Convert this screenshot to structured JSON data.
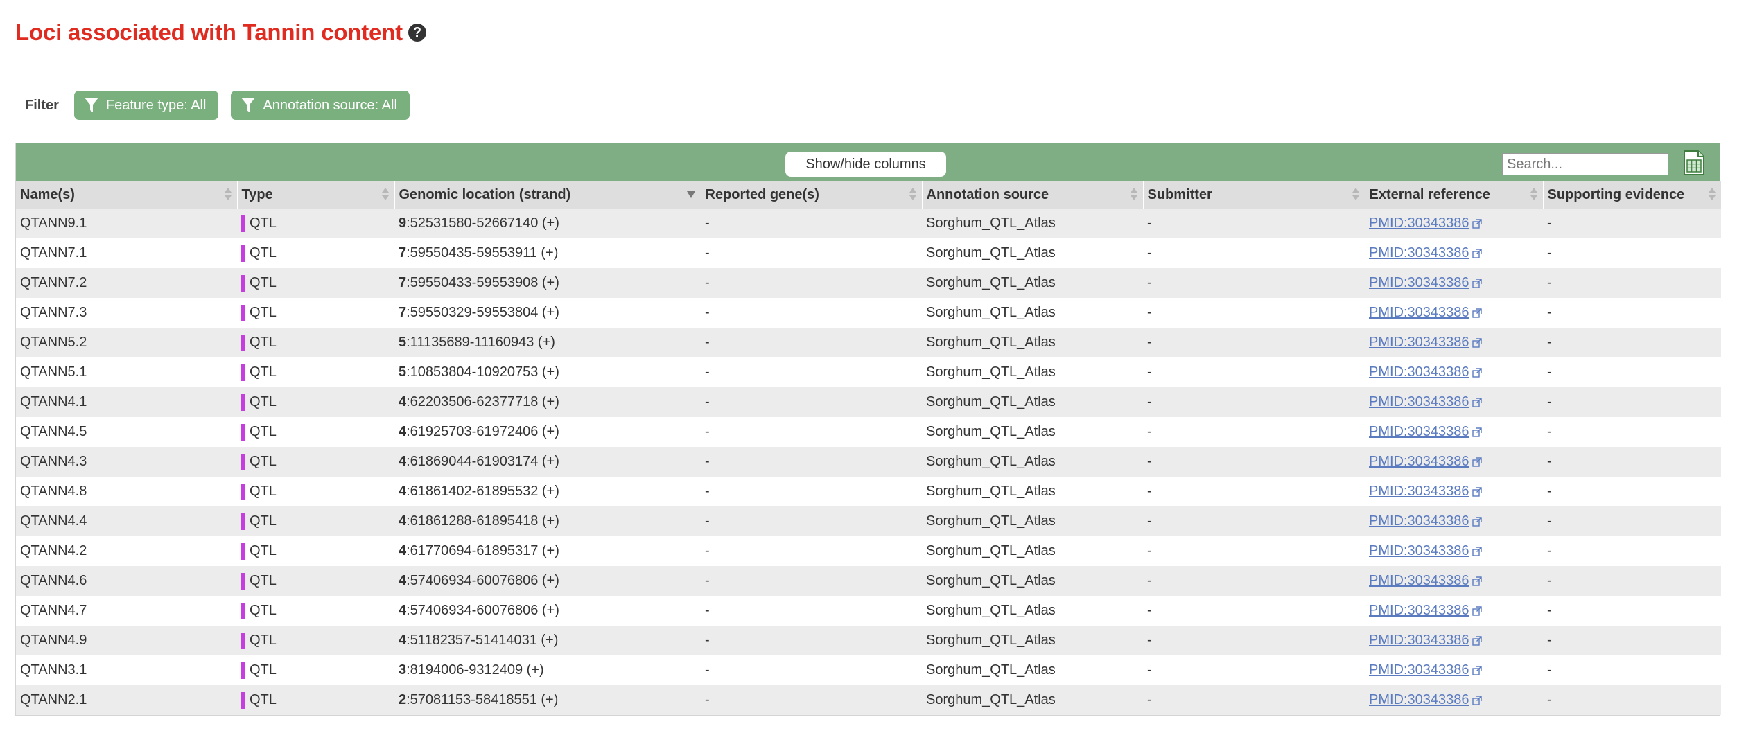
{
  "page": {
    "title": "Loci associated with Tannin content",
    "help_icon": "question-circle-icon"
  },
  "filter": {
    "label": "Filter",
    "buttons": [
      {
        "label": "Feature type: All",
        "icon": "filter-icon"
      },
      {
        "label": "Annotation source: All",
        "icon": "filter-icon"
      }
    ]
  },
  "toolbar": {
    "show_hide_label": "Show/hide columns",
    "search_placeholder": "Search...",
    "export_icon": "spreadsheet-export-icon"
  },
  "colors": {
    "title": "#e02b20",
    "accent_green": "#7fae84",
    "qtl_marker": "#c73ee0",
    "link": "#5b7bc0"
  },
  "table": {
    "columns": [
      "Name(s)",
      "Type",
      "Genomic location (strand)",
      "Reported gene(s)",
      "Annotation source",
      "Submitter",
      "External reference",
      "Supporting evidence"
    ],
    "rows": [
      {
        "name": "QTANN9.1",
        "type": "QTL",
        "chrom": "9",
        "location": ":52531580-52667140 (+)",
        "genes": "-",
        "source": "Sorghum_QTL_Atlas",
        "submitter": "-",
        "reference": "PMID:30343386",
        "evidence": "-"
      },
      {
        "name": "QTANN7.1",
        "type": "QTL",
        "chrom": "7",
        "location": ":59550435-59553911 (+)",
        "genes": "-",
        "source": "Sorghum_QTL_Atlas",
        "submitter": "-",
        "reference": "PMID:30343386",
        "evidence": "-"
      },
      {
        "name": "QTANN7.2",
        "type": "QTL",
        "chrom": "7",
        "location": ":59550433-59553908 (+)",
        "genes": "-",
        "source": "Sorghum_QTL_Atlas",
        "submitter": "-",
        "reference": "PMID:30343386",
        "evidence": "-"
      },
      {
        "name": "QTANN7.3",
        "type": "QTL",
        "chrom": "7",
        "location": ":59550329-59553804 (+)",
        "genes": "-",
        "source": "Sorghum_QTL_Atlas",
        "submitter": "-",
        "reference": "PMID:30343386",
        "evidence": "-"
      },
      {
        "name": "QTANN5.2",
        "type": "QTL",
        "chrom": "5",
        "location": ":11135689-11160943 (+)",
        "genes": "-",
        "source": "Sorghum_QTL_Atlas",
        "submitter": "-",
        "reference": "PMID:30343386",
        "evidence": "-"
      },
      {
        "name": "QTANN5.1",
        "type": "QTL",
        "chrom": "5",
        "location": ":10853804-10920753 (+)",
        "genes": "-",
        "source": "Sorghum_QTL_Atlas",
        "submitter": "-",
        "reference": "PMID:30343386",
        "evidence": "-"
      },
      {
        "name": "QTANN4.1",
        "type": "QTL",
        "chrom": "4",
        "location": ":62203506-62377718 (+)",
        "genes": "-",
        "source": "Sorghum_QTL_Atlas",
        "submitter": "-",
        "reference": "PMID:30343386",
        "evidence": "-"
      },
      {
        "name": "QTANN4.5",
        "type": "QTL",
        "chrom": "4",
        "location": ":61925703-61972406 (+)",
        "genes": "-",
        "source": "Sorghum_QTL_Atlas",
        "submitter": "-",
        "reference": "PMID:30343386",
        "evidence": "-"
      },
      {
        "name": "QTANN4.3",
        "type": "QTL",
        "chrom": "4",
        "location": ":61869044-61903174 (+)",
        "genes": "-",
        "source": "Sorghum_QTL_Atlas",
        "submitter": "-",
        "reference": "PMID:30343386",
        "evidence": "-"
      },
      {
        "name": "QTANN4.8",
        "type": "QTL",
        "chrom": "4",
        "location": ":61861402-61895532 (+)",
        "genes": "-",
        "source": "Sorghum_QTL_Atlas",
        "submitter": "-",
        "reference": "PMID:30343386",
        "evidence": "-"
      },
      {
        "name": "QTANN4.4",
        "type": "QTL",
        "chrom": "4",
        "location": ":61861288-61895418 (+)",
        "genes": "-",
        "source": "Sorghum_QTL_Atlas",
        "submitter": "-",
        "reference": "PMID:30343386",
        "evidence": "-"
      },
      {
        "name": "QTANN4.2",
        "type": "QTL",
        "chrom": "4",
        "location": ":61770694-61895317 (+)",
        "genes": "-",
        "source": "Sorghum_QTL_Atlas",
        "submitter": "-",
        "reference": "PMID:30343386",
        "evidence": "-"
      },
      {
        "name": "QTANN4.6",
        "type": "QTL",
        "chrom": "4",
        "location": ":57406934-60076806 (+)",
        "genes": "-",
        "source": "Sorghum_QTL_Atlas",
        "submitter": "-",
        "reference": "PMID:30343386",
        "evidence": "-"
      },
      {
        "name": "QTANN4.7",
        "type": "QTL",
        "chrom": "4",
        "location": ":57406934-60076806 (+)",
        "genes": "-",
        "source": "Sorghum_QTL_Atlas",
        "submitter": "-",
        "reference": "PMID:30343386",
        "evidence": "-"
      },
      {
        "name": "QTANN4.9",
        "type": "QTL",
        "chrom": "4",
        "location": ":51182357-51414031 (+)",
        "genes": "-",
        "source": "Sorghum_QTL_Atlas",
        "submitter": "-",
        "reference": "PMID:30343386",
        "evidence": "-"
      },
      {
        "name": "QTANN3.1",
        "type": "QTL",
        "chrom": "3",
        "location": ":8194006-9312409 (+)",
        "genes": "-",
        "source": "Sorghum_QTL_Atlas",
        "submitter": "-",
        "reference": "PMID:30343386",
        "evidence": "-"
      },
      {
        "name": "QTANN2.1",
        "type": "QTL",
        "chrom": "2",
        "location": ":57081153-58418551 (+)",
        "genes": "-",
        "source": "Sorghum_QTL_Atlas",
        "submitter": "-",
        "reference": "PMID:30343386",
        "evidence": "-"
      }
    ]
  }
}
